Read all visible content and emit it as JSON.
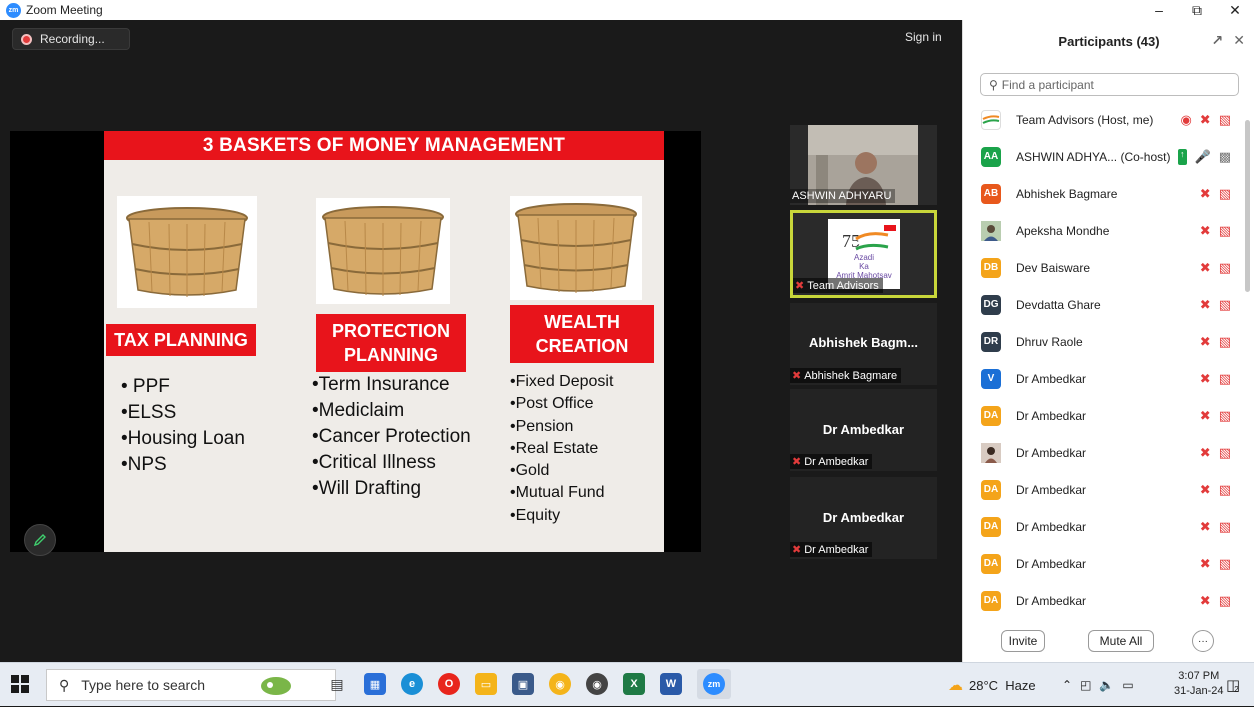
{
  "window": {
    "title": "Zoom Meeting",
    "app_icon": "zm",
    "controls": [
      "minimize-icon",
      "restore-icon",
      "close-icon"
    ]
  },
  "meeting": {
    "recording_label": "Recording...",
    "signin_label": "Sign in"
  },
  "slide": {
    "title": "3 BASKETS OF MONEY MANAGEMENT",
    "columns": [
      {
        "label": "TAX PLANNING",
        "items": [
          "• PPF",
          "•ELSS",
          "•Housing Loan",
          "•NPS"
        ]
      },
      {
        "label_line1": "PROTECTION",
        "label_line2": "PLANNING",
        "items": [
          "•Term Insurance",
          "•Mediclaim",
          "•Cancer Protection",
          "•Critical Illness",
          "•Will Drafting"
        ]
      },
      {
        "label_line1": "WEALTH",
        "label_line2": "CREATION",
        "items": [
          "•Fixed Deposit",
          "•Post Office",
          "•Pension",
          "•Real Estate",
          "•Gold",
          "•Mutual Fund",
          "•Equity"
        ]
      }
    ]
  },
  "tiles": [
    {
      "name_tag": "ASHWIN ADHYARU",
      "type": "video"
    },
    {
      "name_tag": "Team Advisors",
      "type": "logo",
      "logo_line1": "Azadi",
      "logo_line2": "Ka",
      "logo_line3": "Amrit Mahotsav",
      "active": true
    },
    {
      "big_name": "Abhishek  Bagm...",
      "name_tag": "Abhishek Bagmare"
    },
    {
      "big_name": "Dr Ambedkar",
      "name_tag": "Dr Ambedkar"
    },
    {
      "big_name": "Dr Ambedkar",
      "name_tag": "Dr Ambedkar"
    }
  ],
  "participants": {
    "header": "Participants (43)",
    "search_placeholder": "Find a participant",
    "list": [
      {
        "initials": "",
        "name": "Team Advisors (Host, me)",
        "avatar_color": "#ffffff",
        "avatar_type": "logo"
      },
      {
        "initials": "AA",
        "name": "ASHWIN ADHYA... (Co-host)",
        "avatar_color": "#1aa34a"
      },
      {
        "initials": "AB",
        "name": "Abhishek Bagmare",
        "avatar_color": "#e8581c"
      },
      {
        "initials": "",
        "name": "Apeksha Mondhe",
        "avatar_color": "#7aa06e",
        "avatar_type": "photo"
      },
      {
        "initials": "DB",
        "name": "Dev Baisware",
        "avatar_color": "#f4a41a"
      },
      {
        "initials": "DG",
        "name": "Devdatta Ghare",
        "avatar_color": "#2f3d4c"
      },
      {
        "initials": "DR",
        "name": "Dhruv Raole",
        "avatar_color": "#2f3d4c"
      },
      {
        "initials": "V",
        "name": "Dr Ambedkar",
        "avatar_color": "#1a6fd6"
      },
      {
        "initials": "DA",
        "name": "Dr Ambedkar",
        "avatar_color": "#f4a41a"
      },
      {
        "initials": "",
        "name": "Dr Ambedkar",
        "avatar_color": "#9b7a6a",
        "avatar_type": "photo"
      },
      {
        "initials": "DA",
        "name": "Dr Ambedkar",
        "avatar_color": "#f4a41a"
      },
      {
        "initials": "DA",
        "name": "Dr Ambedkar",
        "avatar_color": "#f4a41a"
      },
      {
        "initials": "DA",
        "name": "Dr Ambedkar",
        "avatar_color": "#f4a41a"
      },
      {
        "initials": "DA",
        "name": "Dr Ambedkar",
        "avatar_color": "#f4a41a"
      }
    ],
    "invite_label": "Invite",
    "mute_all_label": "Mute All",
    "more_label": "···"
  },
  "taskbar": {
    "search_placeholder": "Type here to search",
    "weather": "28°C  Haze",
    "time": "3:07 PM",
    "date": "31-Jan-24",
    "notification_count": "2",
    "zoom_label": "zm"
  }
}
